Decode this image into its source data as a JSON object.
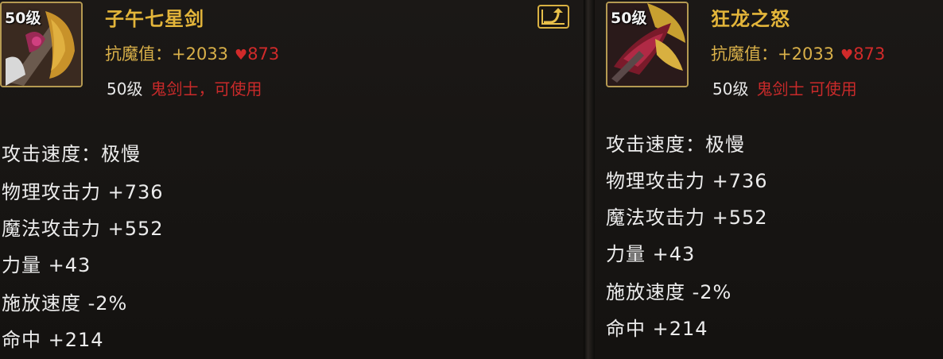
{
  "left_item": {
    "level": "50级",
    "name": "子午七星剑",
    "resist_label": "抗魔值：",
    "resist_value": "+2033",
    "heart_value": "873",
    "req_level": "50级",
    "req_class": "鬼剑士，可使用",
    "stats": [
      "攻击速度：极慢",
      "物理攻击力 +736",
      "魔法攻击力 +552",
      "力量 +43",
      "施放速度 -2%",
      "命中 +214"
    ]
  },
  "right_item": {
    "level": "50级",
    "name": "狂龙之怒",
    "resist_label": "抗魔值：",
    "resist_value": "+2033",
    "heart_value": "873",
    "req_level": "50级",
    "req_class": "鬼剑士 可使用",
    "stats": [
      "攻击速度：极慢",
      "物理攻击力 +736",
      "魔法攻击力 +552",
      "力量 +43",
      "施放速度 -2%",
      "命中 +214"
    ]
  },
  "icons": {
    "export": "export-arrow-icon",
    "heart": "heart-icon"
  },
  "colors": {
    "name_gold": "#e3b53a",
    "resist_gold": "#d9b049",
    "heart_red": "#d12a2a",
    "class_red": "#c92a2a",
    "stat_white": "#ececec"
  }
}
